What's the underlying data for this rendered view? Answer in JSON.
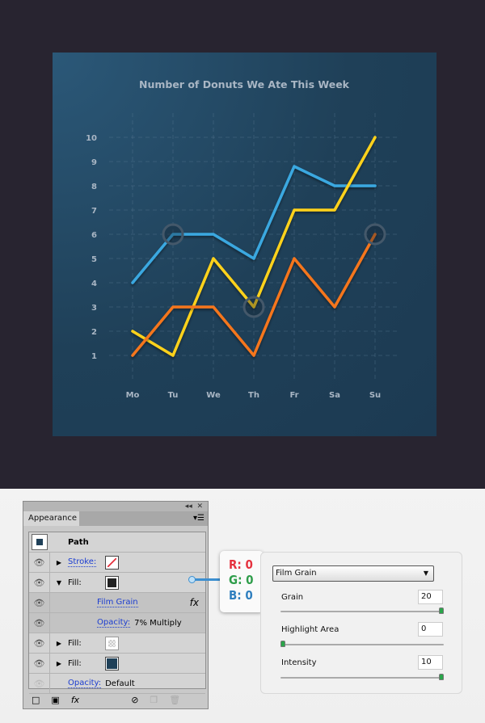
{
  "chart_data": {
    "type": "line",
    "title": "Number of Donuts We Ate This Week",
    "categories": [
      "Mo",
      "Tu",
      "We",
      "Th",
      "Fr",
      "Sa",
      "Su"
    ],
    "yticks": [
      "1",
      "2",
      "3",
      "4",
      "5",
      "6",
      "7",
      "8",
      "9",
      "10"
    ],
    "ylim": [
      1,
      10
    ],
    "grid": true,
    "series": [
      {
        "color": "#3aa8e0",
        "values": [
          4,
          6,
          6,
          5,
          8.8,
          8,
          8
        ]
      },
      {
        "color": "#ffd21a",
        "values": [
          2,
          1,
          5,
          3,
          7,
          7,
          10
        ]
      },
      {
        "color": "#f5761e",
        "values": [
          1,
          3,
          3,
          1,
          5,
          3,
          6
        ]
      }
    ],
    "highlights": [
      {
        "series": 0,
        "day": "Tu"
      },
      {
        "series": 1,
        "day": "Th"
      },
      {
        "series": 2,
        "day": "Su"
      }
    ]
  },
  "panel": {
    "tab": "Appearance",
    "title": "Path",
    "rows": [
      {
        "label": "Stroke:",
        "link": true,
        "expanded": false
      },
      {
        "label": "Fill:",
        "link": false,
        "expanded": true
      },
      {
        "label": "Film Grain",
        "link": true,
        "fx": "fx"
      },
      {
        "label": "Opacity:",
        "link": true,
        "value": "7% Multiply"
      },
      {
        "label": "Fill:",
        "link": false,
        "expanded": false
      },
      {
        "label": "Fill:",
        "link": false,
        "expanded": false
      },
      {
        "label": "Opacity:",
        "link": true,
        "value": "Default"
      }
    ],
    "fx_button": "fx"
  },
  "rgb": {
    "r": "R: 0",
    "g": "G: 0",
    "b": "B: 0"
  },
  "film_grain": {
    "effect": "Film Grain",
    "grain_label": "Grain",
    "grain": "20",
    "highlight_label": "Highlight Area",
    "highlight": "0",
    "intensity_label": "Intensity",
    "intensity": "10",
    "grain_pct": 100,
    "highlight_pct": 0,
    "intensity_pct": 100
  },
  "colors": {
    "red": "#e5313e",
    "green": "#2e9d4a",
    "blue": "#2f7fbf"
  }
}
